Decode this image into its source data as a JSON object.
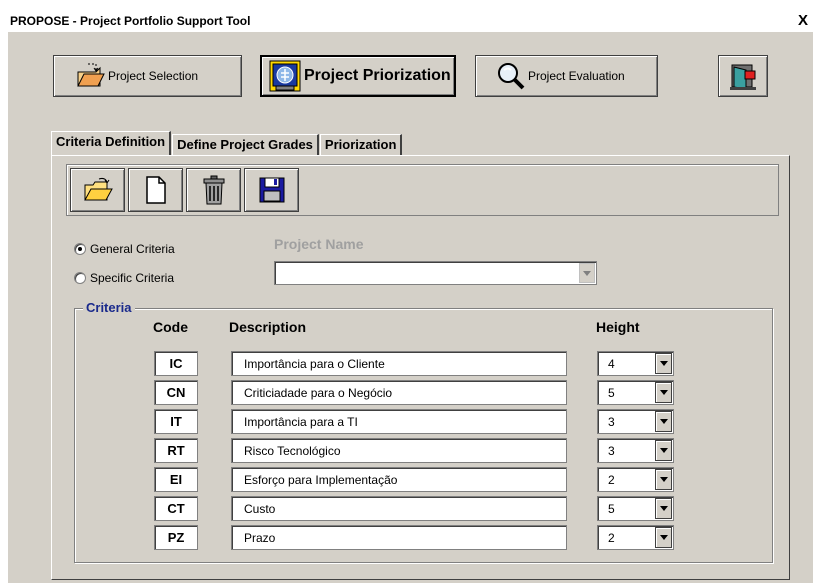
{
  "window": {
    "title": "PROPOSE - Project Portfolio Support Tool",
    "close": "X"
  },
  "toolbar_buttons": {
    "selection": "Project Selection",
    "priorization": "Project Priorization",
    "evaluation": "Project Evaluation"
  },
  "tabs": [
    "Criteria Definition",
    "Define Project Grades",
    "Priorization"
  ],
  "tools": [
    "open-folder-icon",
    "new-document-icon",
    "trash-icon",
    "save-disk-icon"
  ],
  "radios": {
    "general": "General Criteria",
    "specific": "Specific Criteria",
    "selected": "general"
  },
  "project_name": {
    "label": "Project Name",
    "value": ""
  },
  "criteria": {
    "frame_label": "Criteria",
    "headers": {
      "code": "Code",
      "description": "Description",
      "height": "Height"
    },
    "rows": [
      {
        "code": "IC",
        "description": "Importância para o Cliente",
        "height": "4"
      },
      {
        "code": "CN",
        "description": "Criticiadade para o Negócio",
        "height": "5"
      },
      {
        "code": "IT",
        "description": "Importância para a TI",
        "height": "3"
      },
      {
        "code": "RT",
        "description": "Risco Tecnológico",
        "height": "3"
      },
      {
        "code": "EI",
        "description": "Esforço para Implementação",
        "height": "2"
      },
      {
        "code": "CT",
        "description": "Custo",
        "height": "5"
      },
      {
        "code": "PZ",
        "description": "Prazo",
        "height": "2"
      }
    ]
  },
  "colors": {
    "face": "#d4d0c8",
    "frame_label": "#1a2a8c"
  }
}
